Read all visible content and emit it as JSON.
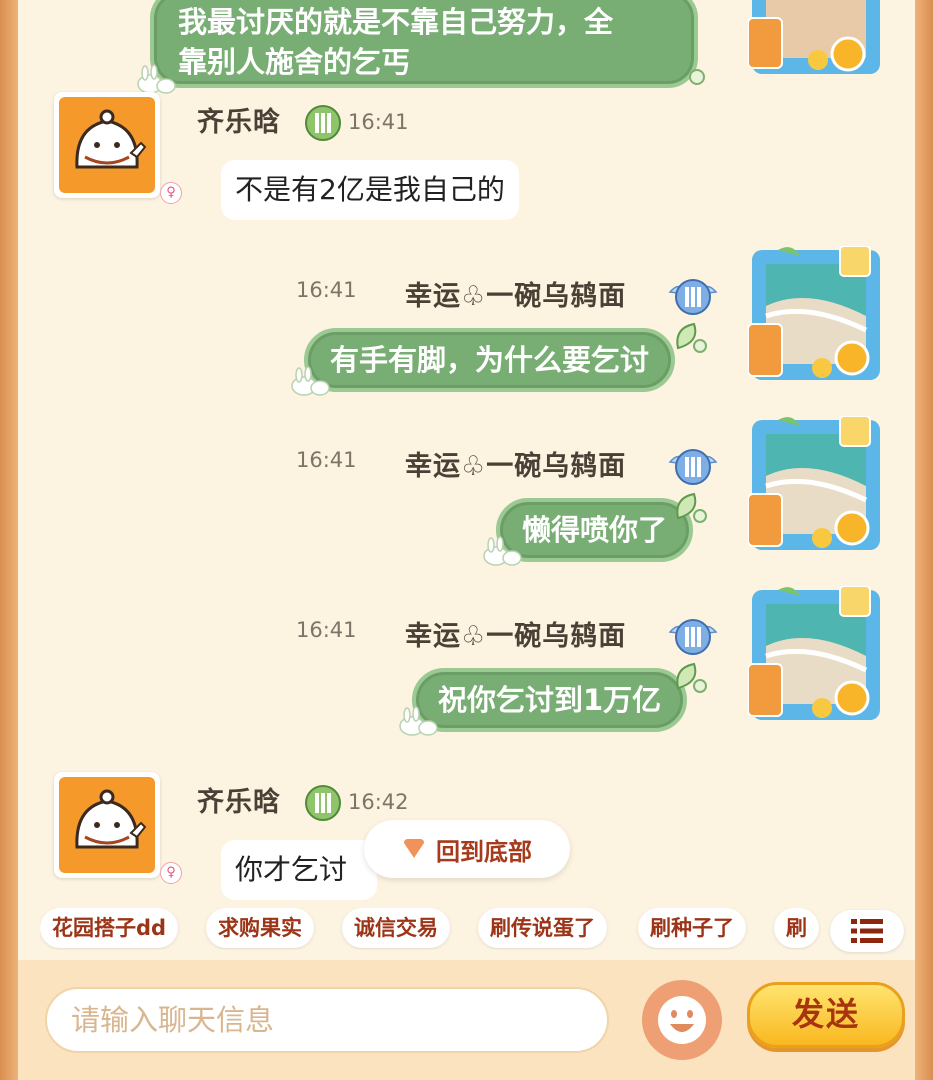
{
  "messages": [
    {
      "side": "right",
      "text": "我最讨厌的就是不靠自己努力，全靠别人施舍的乞丐"
    },
    {
      "side": "left",
      "user": "齐乐晗",
      "time": "16:41",
      "text": "不是有2亿是我自己的"
    },
    {
      "side": "right",
      "user": "幸运♧一碗乌鸫面",
      "time": "16:41",
      "text": "有手有脚，为什么要乞讨"
    },
    {
      "side": "right",
      "user": "幸运♧一碗乌鸫面",
      "time": "16:41",
      "text": "懒得喷你了"
    },
    {
      "side": "right",
      "user": "幸运♧一碗乌鸫面",
      "time": "16:41",
      "text": "祝你乞讨到1万亿"
    },
    {
      "side": "left",
      "user": "齐乐晗",
      "time": "16:42",
      "text": "你才乞讨"
    }
  ],
  "first_message_lines": [
    "我最讨厌的就是不靠自己努力，全",
    "靠别人施舍的乞丐"
  ],
  "gender_symbol": "♀",
  "scroll_to_bottom": {
    "label": "回到底部"
  },
  "quick_tags": [
    "花园搭子dd",
    "求购果实",
    "诚信交易",
    "刷传说蛋了",
    "刷种子了",
    "刷"
  ],
  "input": {
    "placeholder": "请输入聊天信息"
  },
  "send_button": {
    "label": "发送"
  },
  "colors": {
    "bubble_green": "#78ae73",
    "tag_text": "#9c3418",
    "panel_bg": "#fdf3e1"
  }
}
